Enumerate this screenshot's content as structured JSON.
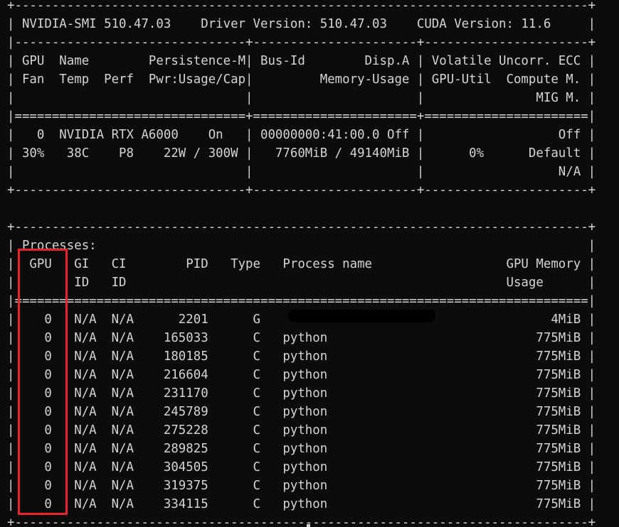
{
  "colors": {
    "background": "#0c0c0c",
    "text": "#d4d4d4",
    "highlight_box": "#e8232b",
    "redaction": "#000000"
  },
  "terminal": {
    "lines": [
      "+-----------------------------------------------------------------------------+",
      "| NVIDIA-SMI 510.47.03    Driver Version: 510.47.03    CUDA Version: 11.6     |",
      "|-------------------------------+----------------------+----------------------+",
      "| GPU  Name        Persistence-M| Bus-Id        Disp.A | Volatile Uncorr. ECC |",
      "| Fan  Temp  Perf  Pwr:Usage/Cap|         Memory-Usage | GPU-Util  Compute M. |",
      "|                               |                      |               MIG M. |",
      "|===============================+======================+======================|",
      "|   0  NVIDIA RTX A6000    On   | 00000000:41:00.0 Off |                  Off |",
      "| 30%   38C    P8    22W / 300W |   7760MiB / 49140MiB |      0%      Default |",
      "|                               |                      |                  N/A |",
      "+-------------------------------+----------------------+----------------------+",
      "",
      "+-----------------------------------------------------------------------------+",
      "| Processes:                                                                  |",
      "|  GPU   GI   CI        PID   Type   Process name                  GPU Memory |",
      "|        ID   ID                                                   Usage      |",
      "|=============================================================================|",
      "|    0   N/A  N/A      2201      G                                       4MiB |",
      "|    0   N/A  N/A    165033      C   python                            775MiB |",
      "|    0   N/A  N/A    180185      C   python                            775MiB |",
      "|    0   N/A  N/A    216604      C   python                            775MiB |",
      "|    0   N/A  N/A    231170      C   python                            775MiB |",
      "|    0   N/A  N/A    245789      C   python                            775MiB |",
      "|    0   N/A  N/A    275228      C   python                            775MiB |",
      "|    0   N/A  N/A    289825      C   python                            775MiB |",
      "|    0   N/A  N/A    304505      C   python                            775MiB |",
      "|    0   N/A  N/A    319375      C   python                            775MiB |",
      "|    0   N/A  N/A    334115      C   python                            775MiB |",
      "+-----------------------------------------------------------------------------+"
    ]
  }
}
